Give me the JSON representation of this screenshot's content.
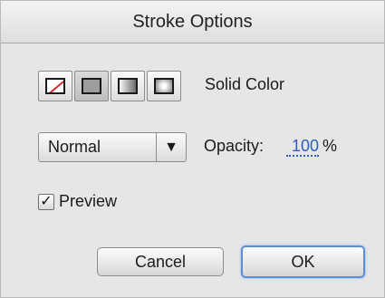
{
  "dialog": {
    "title": "Stroke Options"
  },
  "fill_types": {
    "items": [
      {
        "icon": "none-swatch-icon",
        "selected": false
      },
      {
        "icon": "solid-swatch-icon",
        "selected": true
      },
      {
        "icon": "linear-gradient-icon",
        "selected": false
      },
      {
        "icon": "radial-gradient-icon",
        "selected": false
      }
    ],
    "label": "Solid Color"
  },
  "blend_mode": {
    "value": "Normal",
    "arrow": "▼"
  },
  "opacity": {
    "label": "Opacity:",
    "value": "100",
    "unit": "%"
  },
  "preview": {
    "checked": true,
    "check_glyph": "✓",
    "label": "Preview"
  },
  "buttons": {
    "cancel": "Cancel",
    "ok": "OK"
  },
  "colors": {
    "accent": "#5a8ed6",
    "link": "#2b5cc4",
    "none_slash": "#d6262b"
  }
}
